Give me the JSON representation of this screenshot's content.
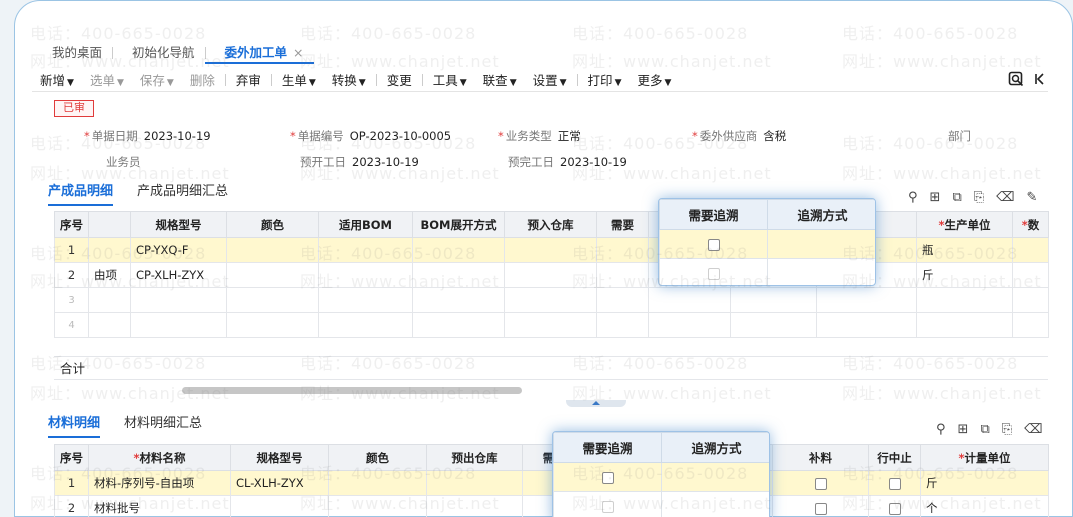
{
  "watermark": {
    "phone": "电话：400-665-0028",
    "site": "网址：www.chanjet.net"
  },
  "tabs": [
    {
      "label": "我的桌面"
    },
    {
      "label": "初始化导航"
    },
    {
      "label": "委外加工单",
      "close": "×"
    }
  ],
  "toolbar": {
    "items": [
      {
        "label": "新增",
        "caret": true
      },
      {
        "label": "选单",
        "caret": true,
        "disabled": true
      },
      {
        "label": "保存",
        "caret": true,
        "disabled": true
      },
      {
        "label": "删除",
        "disabled": true
      },
      {
        "label": "弃审"
      },
      {
        "label": "生单",
        "caret": true
      },
      {
        "label": "转换",
        "caret": true
      },
      {
        "label": "变更"
      },
      {
        "label": "工具",
        "caret": true
      },
      {
        "label": "联查",
        "caret": true
      },
      {
        "label": "设置",
        "caret": true
      },
      {
        "label": "打印",
        "caret": true
      },
      {
        "label": "更多",
        "caret": true
      }
    ],
    "right_icons": [
      "search-doc-icon",
      "first-page-icon"
    ]
  },
  "status": "已审",
  "header": {
    "doc_date": {
      "label": "单据日期",
      "value": "2023-10-19"
    },
    "doc_no": {
      "label": "单据编号",
      "value": "OP-2023-10-0005"
    },
    "biz_type": {
      "label": "业务类型",
      "value": "正常"
    },
    "supplier": {
      "label": "委外供应商",
      "value": "含税"
    },
    "dept": {
      "label": "部门",
      "value": ""
    },
    "salesman": {
      "label": "业务员",
      "value": ""
    },
    "plan_start": {
      "label": "预开工日",
      "value": "2023-10-19"
    },
    "plan_end": {
      "label": "预完工日",
      "value": "2023-10-19"
    }
  },
  "products": {
    "tabs": [
      "产成品明细",
      "产成品明细汇总"
    ],
    "columns": [
      "序号",
      "",
      "规格型号",
      "颜色",
      "适用BOM",
      "BOM展开方式",
      "预入仓库",
      "需要",
      "",
      "",
      "",
      "生产单位",
      "数"
    ],
    "rows": [
      {
        "no": "1",
        "name": "",
        "spec": "CP-YXQ-F",
        "unit": "瓶"
      },
      {
        "no": "2",
        "name": "由项",
        "spec": "CP-XLH-ZYX",
        "unit": "斤"
      },
      {
        "no": "3",
        "name": "",
        "spec": "",
        "unit": ""
      },
      {
        "no": "4",
        "name": "",
        "spec": "",
        "unit": ""
      }
    ],
    "total_label": "合计"
  },
  "materials": {
    "tabs": [
      "材料明细",
      "材料明细汇总"
    ],
    "columns": [
      "序号",
      "材料名称",
      "规格型号",
      "颜色",
      "预出仓库",
      "需",
      "",
      "",
      "补料",
      "行中止",
      "计量单位"
    ],
    "rows": [
      {
        "no": "1",
        "name": "材料-序列号-自由项",
        "spec": "CL-XLH-ZYX",
        "unit": "斤"
      },
      {
        "no": "2",
        "name": "材料批号",
        "spec": "",
        "unit": "个"
      }
    ]
  },
  "popup": {
    "col1": "需要追溯",
    "col2": "追溯方式"
  }
}
